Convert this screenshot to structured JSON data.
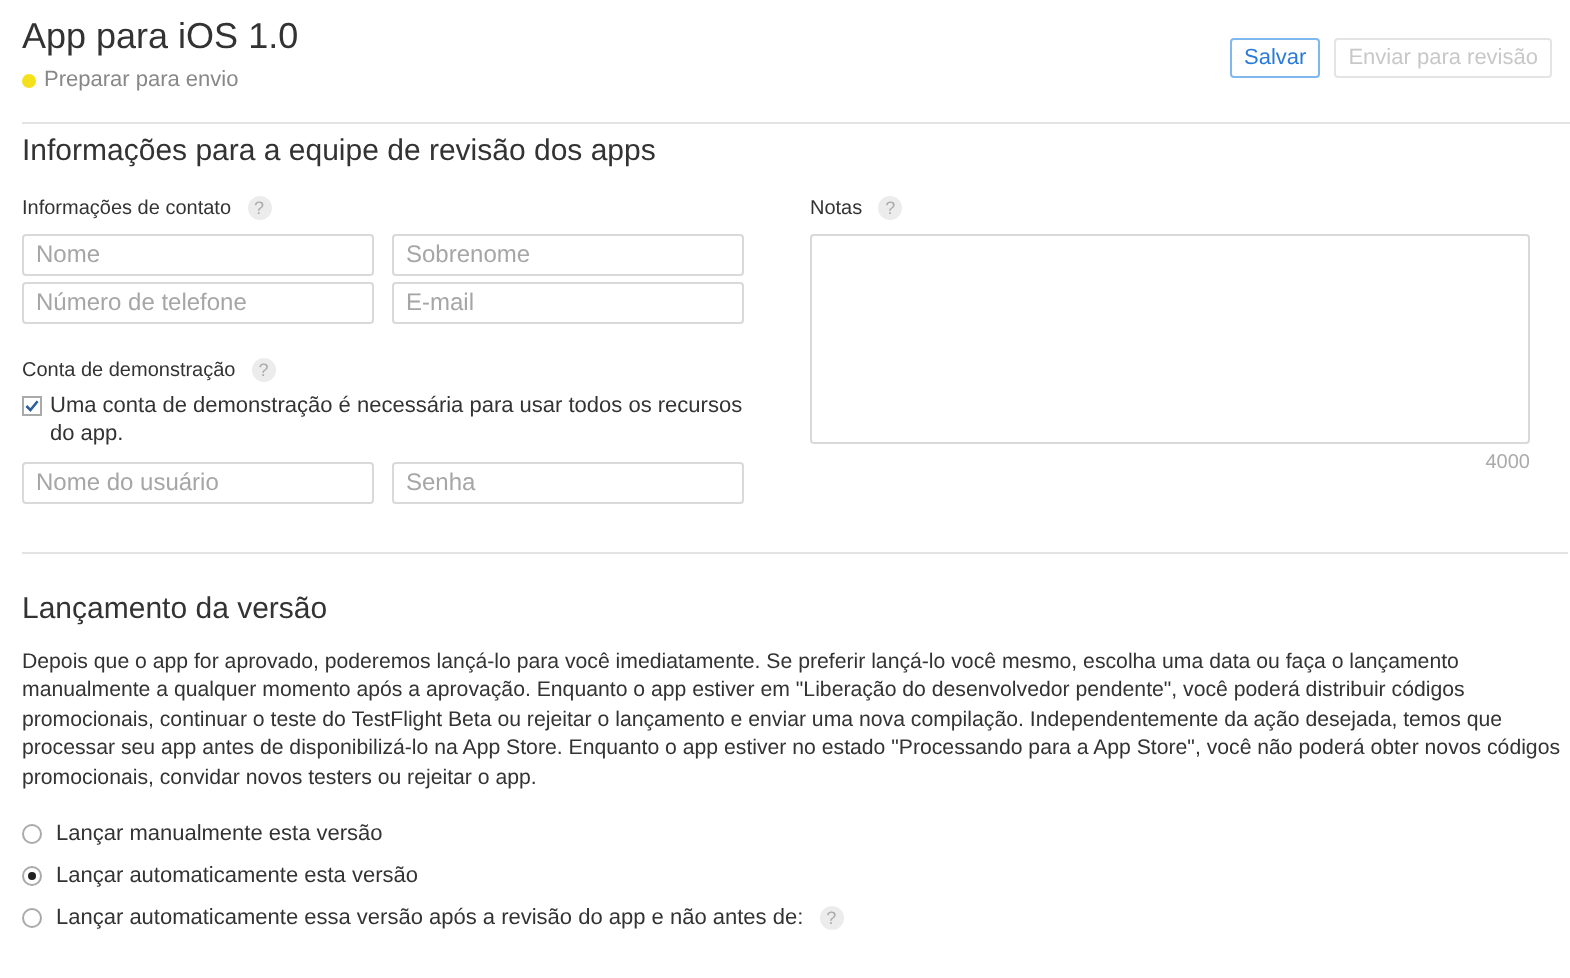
{
  "header": {
    "title": "App para iOS 1.0",
    "status": {
      "label": "Preparar para envio",
      "color": "#f5e11b"
    },
    "buttons": [
      {
        "label": "Salvar",
        "disabled": false
      },
      {
        "label": "Enviar para revisão",
        "disabled": true
      }
    ]
  },
  "review_section": {
    "title": "Informações para a equipe de revisão dos apps",
    "contact": {
      "label": "Informações de contato",
      "help": "?",
      "fields": [
        {
          "placeholder": "Nome"
        },
        {
          "placeholder": "Sobrenome"
        },
        {
          "placeholder": "Número de telefone"
        },
        {
          "placeholder": "E-mail"
        }
      ]
    },
    "demo_account": {
      "label": "Conta de demonstração",
      "help": "?",
      "checkbox": {
        "label": "Uma conta de demonstração é necessária para usar todos os recursos do app.",
        "checked": true
      },
      "fields": [
        {
          "placeholder": "Nome do usuário"
        },
        {
          "placeholder": "Senha"
        }
      ]
    },
    "notes": {
      "label": "Notas",
      "help": "?",
      "counter": "4000"
    }
  },
  "release_section": {
    "title": "Lançamento da versão",
    "description": "Depois que o app for aprovado, poderemos lançá-lo para você imediatamente. Se preferir lançá-lo você mesmo, escolha uma data ou faça o lançamento manualmente a qualquer momento após a aprovação. Enquanto o app estiver em \"Liberação do desenvolvedor pendente\", você poderá distribuir códigos promocionais, continuar o teste do TestFlight Beta ou rejeitar o lançamento e enviar uma nova compilação. Independentemente da ação desejada, temos que processar seu app antes de disponibilizá-lo na App Store. Enquanto o app estiver no estado \"Processando para a App Store\", você não poderá obter novos códigos promocionais, convidar novos testers ou rejeitar o app.",
    "options": [
      {
        "label": "Lançar manualmente esta versão",
        "selected": false
      },
      {
        "label": "Lançar automaticamente esta versão",
        "selected": true
      },
      {
        "label": "Lançar automaticamente essa versão após a revisão do app e não antes de:",
        "selected": false,
        "help": "?"
      }
    ]
  }
}
